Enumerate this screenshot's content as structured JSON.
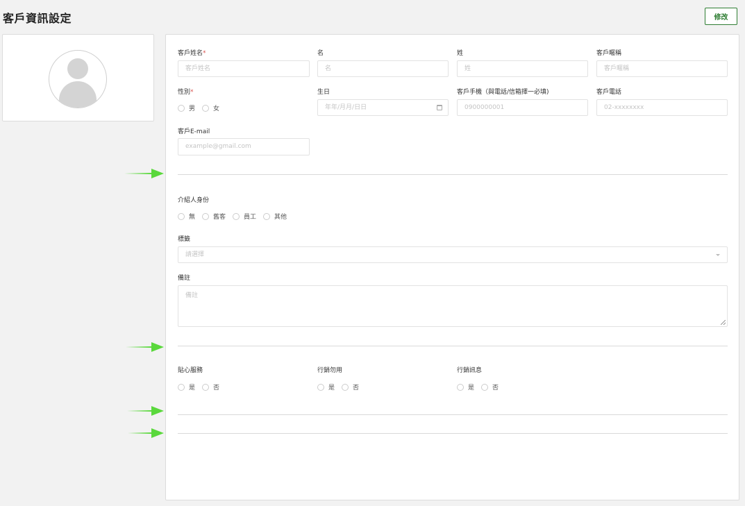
{
  "page": {
    "title": "客戶資訊設定",
    "edit_label": "修改"
  },
  "colors": {
    "accent": "#2e7d32",
    "required": "#d9534f",
    "arrow": "#5ad83c"
  },
  "fields": {
    "customer_name": {
      "label": "客戶姓名",
      "placeholder": "客戶姓名"
    },
    "first_name": {
      "label": "名",
      "placeholder": "名"
    },
    "last_name": {
      "label": "姓",
      "placeholder": "姓"
    },
    "nickname": {
      "label": "客戶暱稱",
      "placeholder": "客戶暱稱"
    },
    "gender": {
      "label": "性別",
      "options": [
        "男",
        "女"
      ]
    },
    "birthday": {
      "label": "生日",
      "placeholder": "年年/月月/日日"
    },
    "mobile": {
      "label": "客戶手機（與電話/信箱擇一必填)",
      "placeholder": "0900000001"
    },
    "phone": {
      "label": "客戶電話",
      "placeholder": "02-xxxxxxxx"
    },
    "email": {
      "label": "客戶E-mail",
      "placeholder": "example@gmail.com"
    },
    "referrer": {
      "label": "介紹人身份",
      "options": [
        "無",
        "舊客",
        "員工",
        "其他"
      ]
    },
    "tags": {
      "label": "標籤",
      "placeholder": "請選擇"
    },
    "notes": {
      "label": "備註",
      "placeholder": "備註"
    },
    "care_service": {
      "label": "貼心服務",
      "options": [
        "是",
        "否"
      ]
    },
    "no_marketing": {
      "label": "行銷勿用",
      "options": [
        "是",
        "否"
      ]
    },
    "marketing_msg": {
      "label": "行銷訊息",
      "options": [
        "是",
        "否"
      ]
    }
  },
  "required_mark": "*"
}
